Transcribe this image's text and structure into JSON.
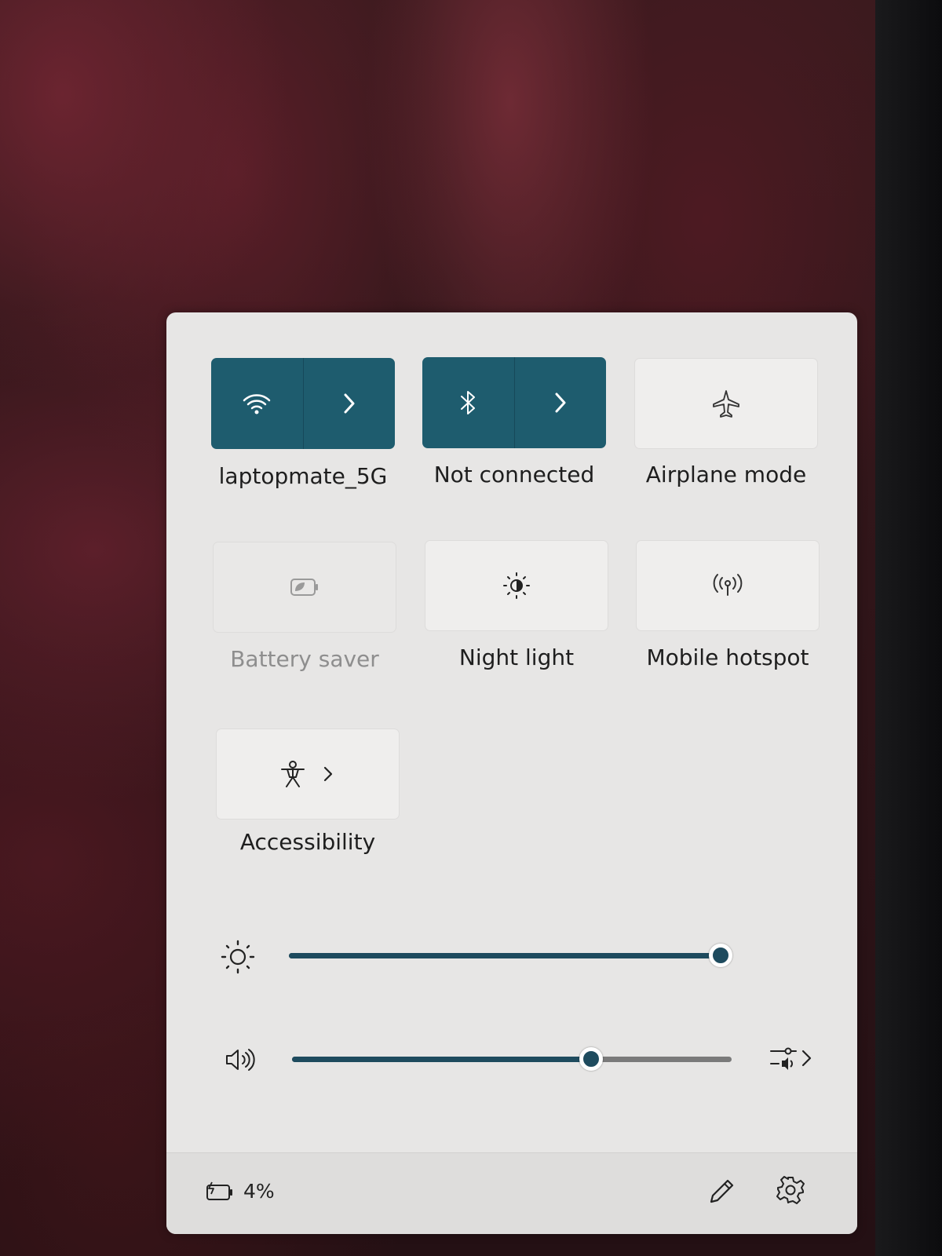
{
  "tiles": {
    "wifi": {
      "label": "laptopmate_5G",
      "active": true,
      "icon": "wifi-icon"
    },
    "bluetooth": {
      "label": "Not connected",
      "active": true,
      "icon": "bluetooth-icon"
    },
    "airplane": {
      "label": "Airplane mode",
      "active": false,
      "icon": "airplane-icon"
    },
    "battery_saver": {
      "label": "Battery saver",
      "active": false,
      "disabled": true,
      "icon": "battery-saver-icon"
    },
    "night_light": {
      "label": "Night light",
      "active": false,
      "icon": "night-light-icon"
    },
    "hotspot": {
      "label": "Mobile hotspot",
      "active": false,
      "icon": "hotspot-icon"
    },
    "accessibility": {
      "label": "Accessibility",
      "active": false,
      "icon": "accessibility-icon"
    }
  },
  "sliders": {
    "brightness": {
      "value_fraction": 1.0,
      "icon": "brightness-icon"
    },
    "volume": {
      "value_fraction": 0.68,
      "icon": "speaker-icon"
    }
  },
  "footer": {
    "battery_percent": "4%",
    "battery_icon": "battery-charging-icon",
    "edit_icon": "pencil-icon",
    "settings_icon": "gear-icon"
  },
  "colors": {
    "accent": "#1e5c6e",
    "panel": "#e7e6e5",
    "slider_fill": "#1e4b5e"
  }
}
